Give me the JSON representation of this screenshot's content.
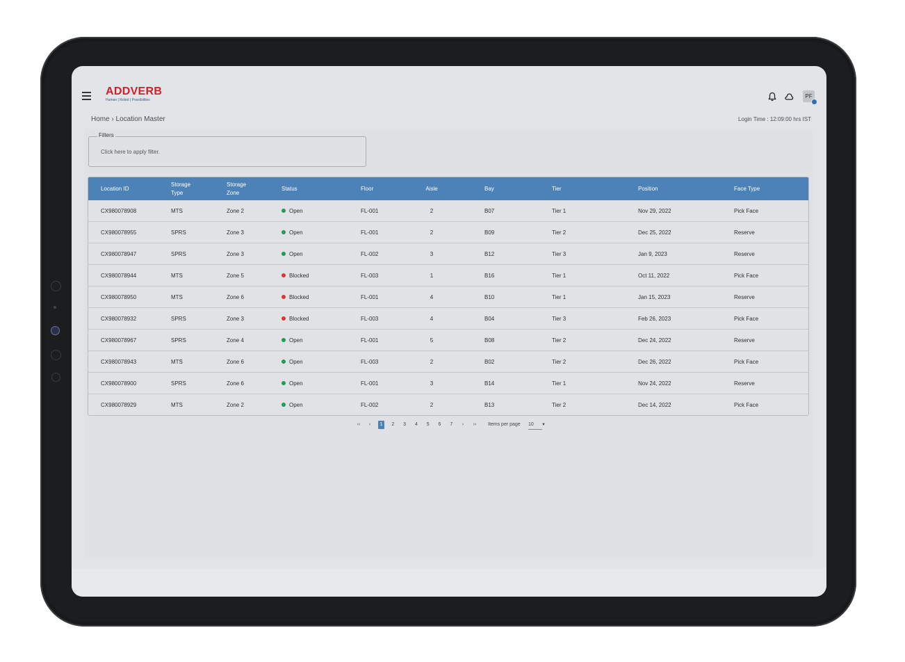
{
  "header": {
    "logo_word": "ADDVERB",
    "logo_tagline": "Human | Robot | Possibilities",
    "avatar_initials": "PF"
  },
  "breadcrumb": "Home › Location Master",
  "login_time": "Login Time : 12:09:00 hrs IST",
  "filters": {
    "legend": "Filters",
    "hint": "Click here to apply filter."
  },
  "table": {
    "columns": [
      "Location ID",
      "Storage Type",
      "Storage Zone",
      "Status",
      "Floor",
      "Aisle",
      "Bay",
      "Tier",
      "Position",
      "Face Type"
    ],
    "rows": [
      [
        "CX980078908",
        "MTS",
        "Zone 2",
        "Open",
        "FL-001",
        "2",
        "B07",
        "Tier 1",
        "Nov 29, 2022",
        "Pick Face"
      ],
      [
        "CX980078955",
        "SPRS",
        "Zone  3",
        "Open",
        "FL-001",
        "2",
        "B09",
        "Tier 2",
        "Dec 25, 2022",
        "Reserve"
      ],
      [
        "CX980078947",
        "SPRS",
        "Zone  3",
        "Open",
        "FL-002",
        "3",
        "B12",
        "Tier 3",
        "Jan 9, 2023",
        "Reserve"
      ],
      [
        "CX980078944",
        "MTS",
        "Zone  5",
        "Blocked",
        "FL-003",
        "1",
        "B16",
        "Tier 1",
        "Oct 11, 2022",
        "Pick Face"
      ],
      [
        "CX980078950",
        "MTS",
        "Zone  6",
        "Blocked",
        "FL-001",
        "4",
        "B10",
        "Tier 1",
        "Jan 15, 2023",
        "Reserve"
      ],
      [
        "CX980078932",
        "SPRS",
        "Zone  3",
        "Blocked",
        "FL-003",
        "4",
        "B04",
        "Tier 3",
        "Feb 26, 2023",
        "Pick Face"
      ],
      [
        "CX980078967",
        "SPRS",
        "Zone  4",
        "Open",
        "FL-001",
        "5",
        "B08",
        "Tier 2",
        "Dec 24, 2022",
        "Reserve"
      ],
      [
        "CX980078943",
        "MTS",
        "Zone  6",
        "Open",
        "FL-003",
        "2",
        "B02",
        "Tier 2",
        "Dec 26, 2022",
        "Pick Face"
      ],
      [
        "CX980078900",
        "SPRS",
        "Zone  6",
        "Open",
        "FL-001",
        "3",
        "B14",
        "Tier 1",
        "Nov 24, 2022",
        "Reserve"
      ],
      [
        "CX980078929",
        "MTS",
        "Zone  2",
        "Open",
        "FL-002",
        "2",
        "B13",
        "Tier 2",
        "Dec 14, 2022",
        "Pick Face"
      ]
    ]
  },
  "status_colors": {
    "Open": "#1f9d55",
    "Blocked": "#d93636"
  },
  "pagination": {
    "first": "‹‹",
    "prev": "‹",
    "pages": [
      "1",
      "2",
      "3",
      "4",
      "5",
      "6",
      "7"
    ],
    "current": "1",
    "next": "›",
    "last": "››",
    "items_per_page_label": "Items per page",
    "items_per_page_value": "10",
    "dropdown_arrow": "▼"
  },
  "icons": [
    "menu-icon",
    "bell-icon",
    "cloud-icon",
    "avatar-verified-icon"
  ]
}
